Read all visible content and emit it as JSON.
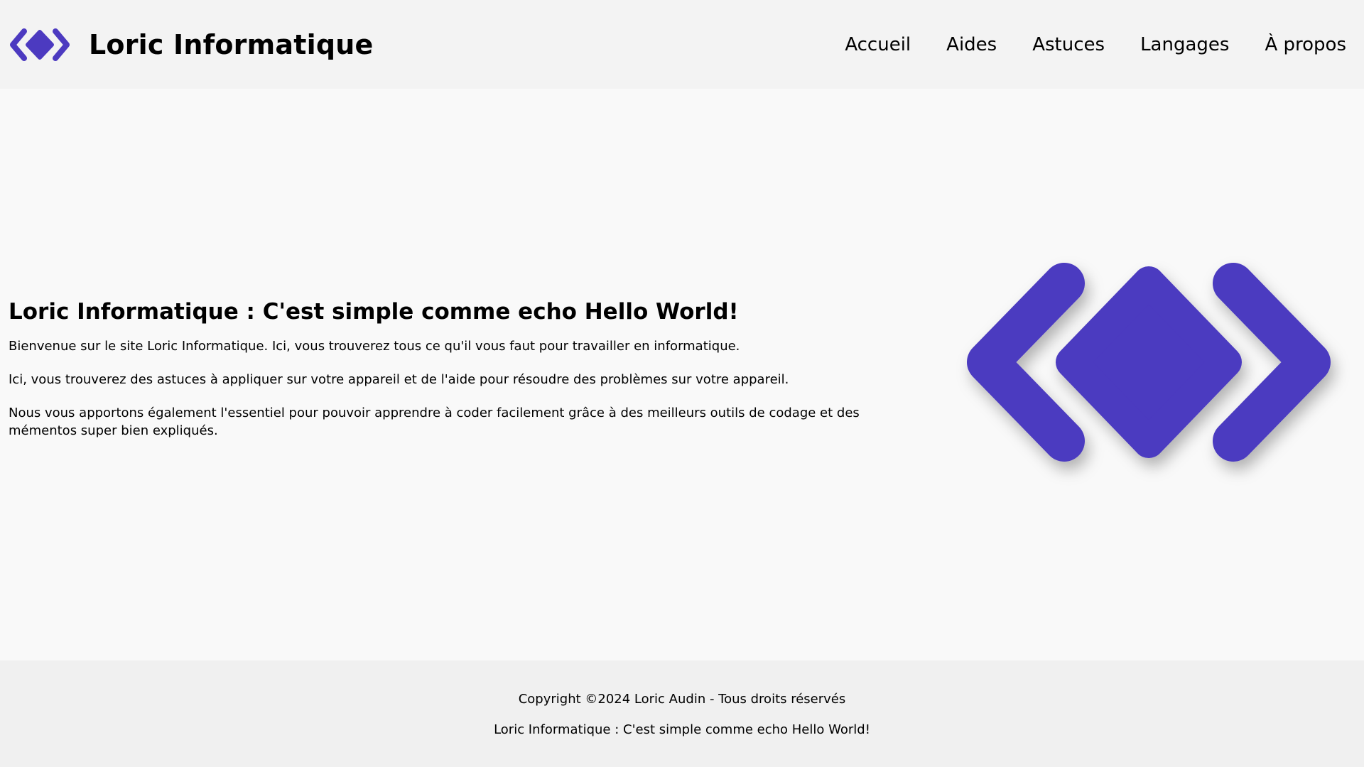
{
  "header": {
    "brand_name": "Loric Informatique",
    "nav": [
      {
        "label": "Accueil"
      },
      {
        "label": "Aides"
      },
      {
        "label": "Astuces"
      },
      {
        "label": "Langages"
      },
      {
        "label": "À propos"
      }
    ]
  },
  "main": {
    "title": "Loric Informatique : C'est simple comme echo Hello World!",
    "paragraphs": [
      "Bienvenue sur le site Loric Informatique. Ici, vous trouverez tous ce qu'il vous faut pour travailler en informatique.",
      "Ici, vous trouverez des astuces à appliquer sur votre appareil et de l'aide pour résoudre des problèmes sur votre appareil.",
      "Nous vous apportons également l'essentiel pour pouvoir apprendre à coder facilement grâce à des meilleurs outils de codage et des mémentos super bien expliqués."
    ]
  },
  "footer": {
    "copyright": "Copyright ©2024 Loric Audin - Tous droits réservés",
    "tagline": "Loric Informatique : C'est simple comme echo Hello World!"
  },
  "colors": {
    "brand": "#4c3ac0",
    "header_bg": "#f3f3f3",
    "main_bg": "#f9f9f9",
    "footer_bg": "#f0f0f0"
  },
  "icons": {
    "brand_logo": "loric-logo-icon",
    "hero_logo": "loric-logo-large-icon"
  }
}
